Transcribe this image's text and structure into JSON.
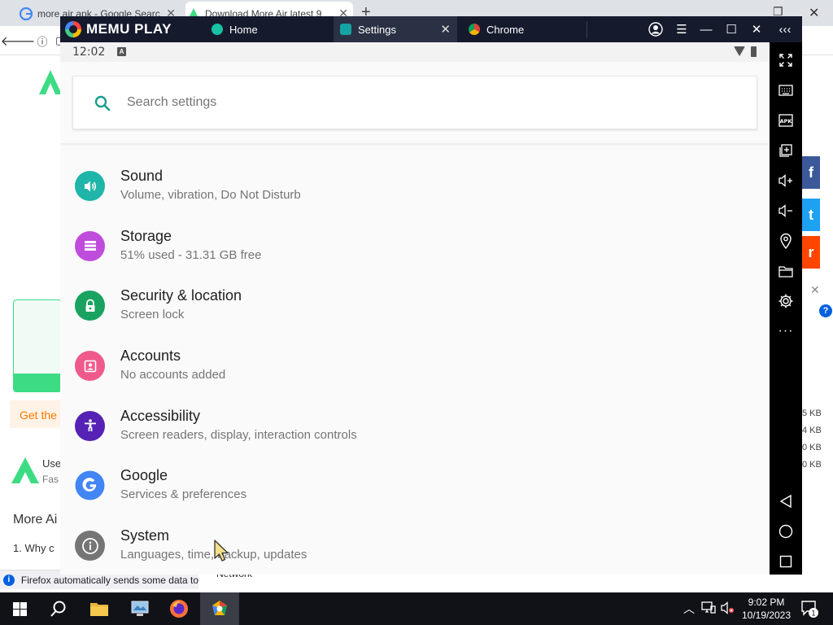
{
  "firefox": {
    "tabs": [
      {
        "title": "more air apk - Google Searc",
        "active": false
      },
      {
        "title": "Download More Air latest 9",
        "active": true
      }
    ],
    "new_tab_label": "+",
    "notification_text": "Firefox automatically sends some data to",
    "bg_texts": {
      "get_the": "Get the",
      "use": "Use",
      "fas": "Fas",
      "more_ai": "More Ai",
      "why_c": "1. Why c",
      "sizes": [
        "5 KB",
        "4 KB",
        "0 KB",
        "0 KB"
      ],
      "network": "Network"
    }
  },
  "memu": {
    "brand": "MEMU PLAY",
    "tabs": [
      {
        "label": "Home",
        "active": false
      },
      {
        "label": "Settings",
        "active": true
      },
      {
        "label": "Chrome",
        "active": false
      }
    ]
  },
  "android": {
    "status_time": "12:02",
    "search_placeholder": "Search settings",
    "settings": [
      {
        "title": "Sound",
        "subtitle": "Volume, vibration, Do Not Disturb",
        "icon": "volume-icon",
        "color": "#1fb5a8"
      },
      {
        "title": "Storage",
        "subtitle": "51% used - 31.31 GB free",
        "icon": "storage-icon",
        "color": "#c04cdc"
      },
      {
        "title": "Security & location",
        "subtitle": "Screen lock",
        "icon": "lock-icon",
        "color": "#1aa260"
      },
      {
        "title": "Accounts",
        "subtitle": "No accounts added",
        "icon": "account-icon",
        "color": "#ef5a8c"
      },
      {
        "title": "Accessibility",
        "subtitle": "Screen readers, display, interaction controls",
        "icon": "accessibility-icon",
        "color": "#5522b5"
      },
      {
        "title": "Google",
        "subtitle": "Services & preferences",
        "icon": "google-icon",
        "color": "#4285f4"
      },
      {
        "title": "System",
        "subtitle": "Languages, time, backup, updates",
        "icon": "info-icon",
        "color": "#757575"
      }
    ]
  },
  "taskbar": {
    "time": "9:02 PM",
    "date": "10/19/2023",
    "notification_count": "1"
  }
}
